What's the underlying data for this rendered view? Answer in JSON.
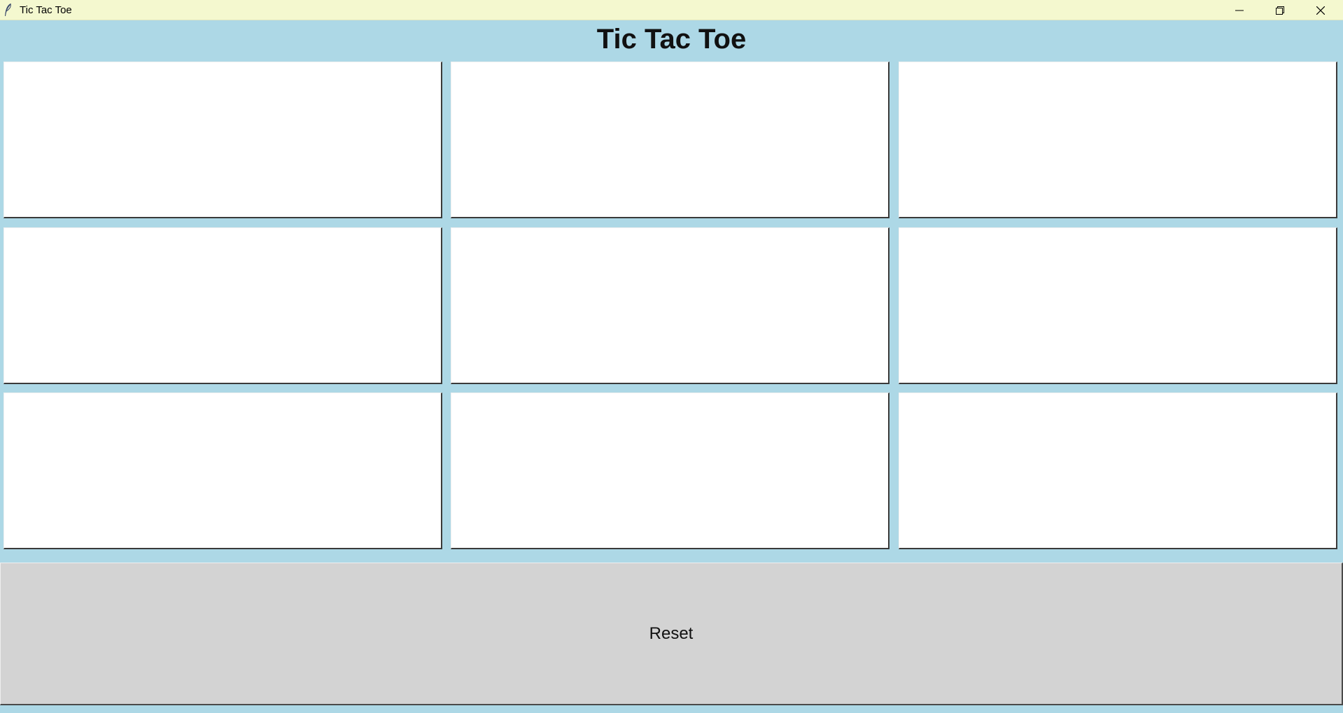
{
  "window": {
    "title": "Tic Tac Toe",
    "icon": "feather-icon",
    "controls": [
      "minimize-icon",
      "restore-icon",
      "close-icon"
    ]
  },
  "game": {
    "heading": "Tic Tac Toe",
    "board": [
      [
        "",
        "",
        ""
      ],
      [
        "",
        "",
        ""
      ],
      [
        "",
        "",
        ""
      ]
    ],
    "reset_label": "Reset"
  },
  "colors": {
    "background": "#add8e6",
    "cell": "#ffffff",
    "reset_button": "#d3d3d3",
    "titlebar": "#f4f8cf"
  }
}
